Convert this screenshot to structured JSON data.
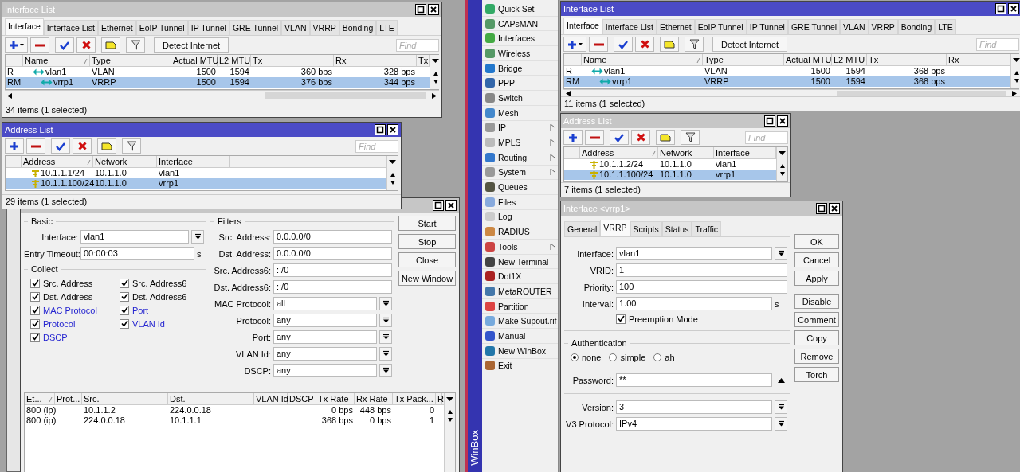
{
  "left": {
    "interface_list": {
      "title": "Interface List",
      "active": false,
      "tabs": [
        {
          "label": "Interface",
          "selected": true
        },
        {
          "label": "Interface List",
          "selected": false
        },
        {
          "label": "Ethernet",
          "selected": false
        },
        {
          "label": "EoIP Tunnel",
          "selected": false
        },
        {
          "label": "IP Tunnel",
          "selected": false
        },
        {
          "label": "GRE Tunnel",
          "selected": false
        },
        {
          "label": "VLAN",
          "selected": false
        },
        {
          "label": "VRRP",
          "selected": false
        },
        {
          "label": "Bonding",
          "selected": false
        },
        {
          "label": "LTE",
          "selected": false
        }
      ],
      "detect_button": "Detect Internet",
      "find_placeholder": "Find",
      "columns": [
        "Name",
        "Type",
        "Actual MTU",
        "L2 MTU",
        "Tx",
        "Rx",
        "Tx"
      ],
      "rows": [
        {
          "flags": "R",
          "name": "vlan1",
          "type": "VLAN",
          "actual_mtu": "1500",
          "l2_mtu": "1594",
          "tx": "360 bps",
          "rx": "328 bps",
          "selected": false,
          "children": [
            {
              "flags": "RM",
              "name": "vrrp1",
              "type": "VRRP",
              "actual_mtu": "1500",
              "l2_mtu": "1594",
              "tx": "376 bps",
              "rx": "344 bps",
              "selected": true
            }
          ]
        }
      ],
      "status": "34 items (1 selected)"
    },
    "address_list": {
      "title": "Address List",
      "active": true,
      "find_placeholder": "Find",
      "columns": [
        "Address",
        "Network",
        "Interface"
      ],
      "rows": [
        {
          "address": "10.1.1.1/24",
          "network": "10.1.1.0",
          "interface": "vlan1",
          "selected": false
        },
        {
          "address": "10.1.1.100/24",
          "network": "10.1.1.0",
          "interface": "vrrp1",
          "selected": true
        }
      ],
      "status": "29 items (1 selected)"
    },
    "torch": {
      "active": false,
      "basic": {
        "heading": "Basic",
        "interface_label": "Interface:",
        "interface": "vlan1",
        "timeout_label": "Entry Timeout:",
        "timeout": "00:00:03",
        "timeout_unit": "s"
      },
      "collect": {
        "heading": "Collect",
        "options": [
          {
            "label": "Src. Address",
            "checked": true,
            "highlighted": false
          },
          {
            "label": "Src. Address6",
            "checked": true,
            "highlighted": false
          },
          {
            "label": "Dst. Address",
            "checked": true,
            "highlighted": false
          },
          {
            "label": "Dst. Address6",
            "checked": true,
            "highlighted": false
          },
          {
            "label": "MAC Protocol",
            "checked": true,
            "highlighted": true
          },
          {
            "label": "Port",
            "checked": true,
            "highlighted": true
          },
          {
            "label": "Protocol",
            "checked": true,
            "highlighted": true
          },
          {
            "label": "VLAN Id",
            "checked": true,
            "highlighted": true
          },
          {
            "label": "DSCP",
            "checked": true,
            "highlighted": true
          }
        ]
      },
      "filters": {
        "heading": "Filters",
        "fields": [
          {
            "label": "Src. Address:",
            "value": "0.0.0.0/0",
            "kind": "text"
          },
          {
            "label": "Dst. Address:",
            "value": "0.0.0.0/0",
            "kind": "text"
          },
          {
            "label": "Src. Address6:",
            "value": "::/0",
            "kind": "text"
          },
          {
            "label": "Dst. Address6:",
            "value": "::/0",
            "kind": "text"
          },
          {
            "label": "MAC Protocol:",
            "value": "all",
            "kind": "dropdown"
          },
          {
            "label": "Protocol:",
            "value": "any",
            "kind": "dropdown"
          },
          {
            "label": "Port:",
            "value": "any",
            "kind": "dropdown"
          },
          {
            "label": "VLAN Id:",
            "value": "any",
            "kind": "dropdown"
          },
          {
            "label": "DSCP:",
            "value": "any",
            "kind": "dropdown"
          }
        ]
      },
      "buttons": [
        "Start",
        "Stop",
        "Close",
        "New Window"
      ],
      "columns": [
        "Et...",
        "Prot...",
        "Src.",
        "Dst.",
        "VLAN Id",
        "DSCP",
        "Tx Rate",
        "Rx Rate",
        "Tx Pack...",
        "R"
      ],
      "rows": [
        {
          "ethertype": "800 (ip)",
          "src": "10.1.1.2",
          "dst": "224.0.0.18",
          "tx_rate": "0 bps",
          "rx_rate": "448 bps",
          "tx_packets": "0"
        },
        {
          "ethertype": "800 (ip)",
          "src": "224.0.0.18",
          "dst": "10.1.1.1",
          "tx_rate": "368 bps",
          "rx_rate": "0 bps",
          "tx_packets": "1"
        }
      ]
    }
  },
  "winbox_menu": {
    "brand": "WinBox",
    "items": [
      {
        "label": "Quick Set",
        "submenu": false
      },
      {
        "label": "CAPsMAN",
        "submenu": false
      },
      {
        "label": "Interfaces",
        "submenu": false
      },
      {
        "label": "Wireless",
        "submenu": false
      },
      {
        "label": "Bridge",
        "submenu": false
      },
      {
        "label": "PPP",
        "submenu": false
      },
      {
        "label": "Switch",
        "submenu": false
      },
      {
        "label": "Mesh",
        "submenu": false
      },
      {
        "label": "IP",
        "submenu": true
      },
      {
        "label": "MPLS",
        "submenu": true
      },
      {
        "label": "Routing",
        "submenu": true
      },
      {
        "label": "System",
        "submenu": true
      },
      {
        "label": "Queues",
        "submenu": false
      },
      {
        "label": "Files",
        "submenu": false
      },
      {
        "label": "Log",
        "submenu": false
      },
      {
        "label": "RADIUS",
        "submenu": false
      },
      {
        "label": "Tools",
        "submenu": true
      },
      {
        "label": "New Terminal",
        "submenu": false
      },
      {
        "label": "Dot1X",
        "submenu": false
      },
      {
        "label": "MetaROUTER",
        "submenu": false
      },
      {
        "label": "Partition",
        "submenu": false
      },
      {
        "label": "Make Supout.rif",
        "submenu": false
      },
      {
        "label": "Manual",
        "submenu": false
      },
      {
        "label": "New WinBox",
        "submenu": false
      },
      {
        "label": "Exit",
        "submenu": false
      }
    ]
  },
  "right": {
    "interface_list": {
      "title": "Interface List",
      "active": true,
      "tabs": [
        {
          "label": "Interface",
          "selected": true
        },
        {
          "label": "Interface List",
          "selected": false
        },
        {
          "label": "Ethernet",
          "selected": false
        },
        {
          "label": "EoIP Tunnel",
          "selected": false
        },
        {
          "label": "IP Tunnel",
          "selected": false
        },
        {
          "label": "GRE Tunnel",
          "selected": false
        },
        {
          "label": "VLAN",
          "selected": false
        },
        {
          "label": "VRRP",
          "selected": false
        },
        {
          "label": "Bonding",
          "selected": false
        },
        {
          "label": "LTE",
          "selected": false
        }
      ],
      "detect_button": "Detect Internet",
      "find_placeholder": "Find",
      "columns": [
        "Name",
        "Type",
        "Actual MTU",
        "L2 MTU",
        "Tx",
        "Rx"
      ],
      "rows": [
        {
          "flags": "R",
          "name": "vlan1",
          "type": "VLAN",
          "actual_mtu": "1500",
          "l2_mtu": "1594",
          "tx": "368 bps",
          "selected": false,
          "children": [
            {
              "flags": "RM",
              "name": "vrrp1",
              "type": "VRRP",
              "actual_mtu": "1500",
              "l2_mtu": "1594",
              "tx": "368 bps",
              "selected": true
            }
          ]
        }
      ],
      "status": "11 items (1 selected)"
    },
    "address_list": {
      "title": "Address List",
      "active": false,
      "find_placeholder": "Find",
      "columns": [
        "Address",
        "Network",
        "Interface"
      ],
      "rows": [
        {
          "address": "10.1.1.2/24",
          "network": "10.1.1.0",
          "interface": "vlan1",
          "selected": false
        },
        {
          "address": "10.1.1.100/24",
          "network": "10.1.1.0",
          "interface": "vrrp1",
          "selected": true
        }
      ],
      "status": "7 items (1 selected)"
    },
    "interface_window": {
      "title": "Interface <vrrp1>",
      "active": false,
      "tabs": [
        {
          "label": "General",
          "selected": false
        },
        {
          "label": "VRRP",
          "selected": true
        },
        {
          "label": "Scripts",
          "selected": false
        },
        {
          "label": "Status",
          "selected": false
        },
        {
          "label": "Traffic",
          "selected": false
        }
      ],
      "fields": [
        {
          "label": "Interface:",
          "value": "vlan1",
          "kind": "dropdown"
        },
        {
          "label": "VRID:",
          "value": "1",
          "kind": "text"
        },
        {
          "label": "Priority:",
          "value": "100",
          "kind": "text"
        },
        {
          "label": "Interval:",
          "value": "1.00",
          "kind": "text",
          "unit": "s"
        }
      ],
      "preemption": {
        "label": "Preemption Mode",
        "checked": true
      },
      "authentication": {
        "heading": "Authentication",
        "options": [
          {
            "label": "none",
            "selected": true
          },
          {
            "label": "simple",
            "selected": false
          },
          {
            "label": "ah",
            "selected": false
          }
        ]
      },
      "password": {
        "label": "Password:",
        "value": "**"
      },
      "version_fields": [
        {
          "label": "Version:",
          "value": "3",
          "kind": "dropdown"
        },
        {
          "label": "V3 Protocol:",
          "value": "IPv4",
          "kind": "dropdown"
        }
      ],
      "buttons": [
        "OK",
        "Cancel",
        "Apply",
        "Disable",
        "Comment",
        "Copy",
        "Remove",
        "Torch"
      ]
    }
  }
}
